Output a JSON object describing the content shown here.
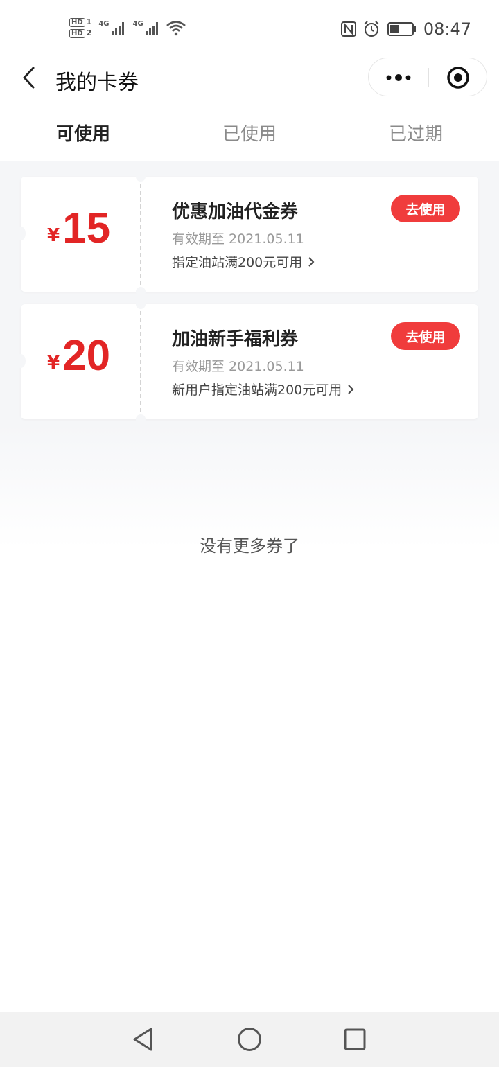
{
  "status_bar": {
    "sim1": "HD",
    "sim1_index": "1",
    "sim2": "HD",
    "sim2_index": "2",
    "network1": "4G",
    "network2": "4G",
    "time": "08:47",
    "icons": [
      "nfc-icon",
      "alarm-icon",
      "battery-icon",
      "wifi-icon",
      "signal-icon"
    ]
  },
  "header": {
    "title": "我的卡券",
    "back_icon": "chevron-left-icon",
    "capsule_icons": [
      "more-dots-icon",
      "target-close-icon"
    ]
  },
  "tabs": [
    {
      "label": "可使用",
      "active": true
    },
    {
      "label": "已使用",
      "active": false
    },
    {
      "label": "已过期",
      "active": false
    }
  ],
  "coupons": [
    {
      "currency": "¥",
      "amount": "15",
      "name": "优惠加油代金券",
      "expiry": "有效期至 2021.05.11",
      "condition": "指定油站满200元可用",
      "button": "去使用"
    },
    {
      "currency": "¥",
      "amount": "20",
      "name": "加油新手福利券",
      "expiry": "有效期至 2021.05.11",
      "condition": "新用户指定油站满200元可用",
      "button": "去使用"
    }
  ],
  "footer_text": "没有更多券了",
  "colors": {
    "accent_red": "#e22525",
    "button_red": "#f03c3c",
    "background": "#f5f6f8"
  },
  "navbar": [
    "back-triangle-icon",
    "home-circle-icon",
    "recents-square-icon"
  ]
}
